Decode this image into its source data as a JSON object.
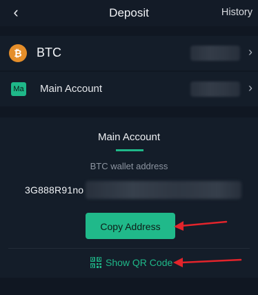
{
  "header": {
    "back_icon": "chevron-left-icon",
    "back_glyph": "‹",
    "title": "Deposit",
    "history_label": "History"
  },
  "coin_row": {
    "icon": "bitcoin-icon",
    "icon_glyph": "₿",
    "label": "BTC",
    "chevron_glyph": "›"
  },
  "account_row": {
    "icon": "account-icon",
    "icon_text": "Ma",
    "label": "Main Account",
    "chevron_glyph": "›"
  },
  "card": {
    "title": "Main Account",
    "address_caption": "BTC wallet address",
    "address_visible": "3G888R91no",
    "copy_button_label": "Copy Address",
    "qr_icon": "qr-code-icon",
    "qr_label": "Show QR Code"
  },
  "colors": {
    "accent_green": "#20b98a",
    "bitcoin_orange": "#e58e2a",
    "annotation_red": "#e3242b",
    "background": "#101722",
    "panel": "#141d29"
  }
}
